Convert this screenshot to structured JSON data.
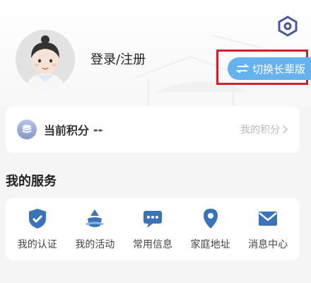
{
  "header": {
    "login_label": "登录/注册",
    "switch_label": "切换长辈版"
  },
  "points": {
    "label": "当前积分",
    "value": "--",
    "my_points_label": "我的积分"
  },
  "services": {
    "title": "我的服务",
    "items": [
      {
        "label": "我的认证",
        "icon": "shield-check-icon"
      },
      {
        "label": "我的活动",
        "icon": "activity-icon"
      },
      {
        "label": "常用信息",
        "icon": "info-chat-icon"
      },
      {
        "label": "家庭地址",
        "icon": "location-pin-icon"
      },
      {
        "label": "消息中心",
        "icon": "mail-icon"
      }
    ]
  },
  "colors": {
    "accent": "#4a90e2",
    "switch_bg": "#66b2ef",
    "highlight": "#d0202a"
  }
}
